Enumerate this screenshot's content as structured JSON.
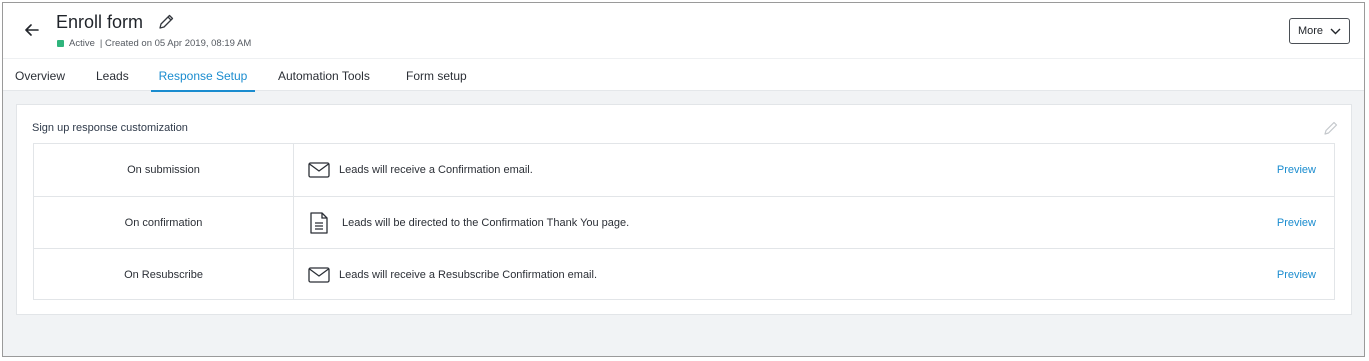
{
  "header": {
    "title": "Enroll form",
    "status": "Active",
    "created": "| Created on 05 Apr 2019, 08:19 AM",
    "more_label": "More"
  },
  "tabs": [
    {
      "label": "Overview"
    },
    {
      "label": "Leads"
    },
    {
      "label": "Response Setup",
      "active": true
    },
    {
      "label": "Automation Tools"
    },
    {
      "label": "Form setup"
    }
  ],
  "section": {
    "title": "Sign up response customization",
    "rows": [
      {
        "label": "On submission",
        "icon": "envelope-icon",
        "text": "Leads will receive a Confirmation email.",
        "action": "Preview"
      },
      {
        "label": "On confirmation",
        "icon": "document-icon",
        "text": "Leads will be directed to the Confirmation Thank You page.",
        "action": "Preview"
      },
      {
        "label": "On Resubscribe",
        "icon": "envelope-icon",
        "text": "Leads will receive a Resubscribe Confirmation email.",
        "action": "Preview"
      }
    ]
  },
  "colors": {
    "accent": "#1a8ccf",
    "status_active": "#2fb47c"
  }
}
